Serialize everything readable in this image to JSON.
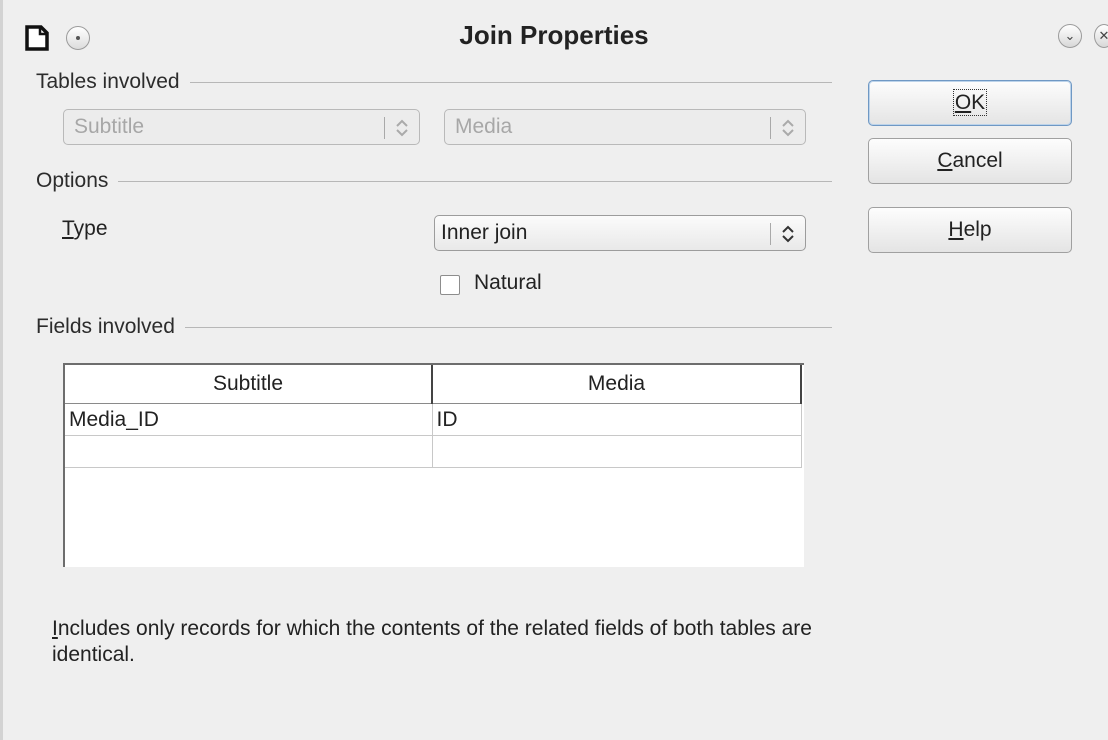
{
  "window": {
    "title": "Join Properties",
    "minimize_glyph": "⌄",
    "close_glyph": "✕",
    "icons": [
      "document-icon",
      "menu-icon"
    ]
  },
  "tables_involved": {
    "label": "Tables involved",
    "left_table": "Subtitle",
    "right_table": "Media"
  },
  "options": {
    "label": "Options",
    "type_label": "Type",
    "type_value": "Inner join",
    "natural_label": "Natural",
    "natural_checked": false
  },
  "fields_involved": {
    "label": "Fields involved",
    "columns": [
      "Subtitle",
      "Media"
    ],
    "rows": [
      [
        "Media_ID",
        "ID"
      ],
      [
        "",
        ""
      ]
    ]
  },
  "description": "Includes only records for which the contents of the related fields of both tables are identical.",
  "buttons": {
    "ok": "OK",
    "cancel": "Cancel",
    "help": "Help"
  },
  "colors": {
    "background": "#efefef",
    "default_button_border": "#6f98c4"
  }
}
